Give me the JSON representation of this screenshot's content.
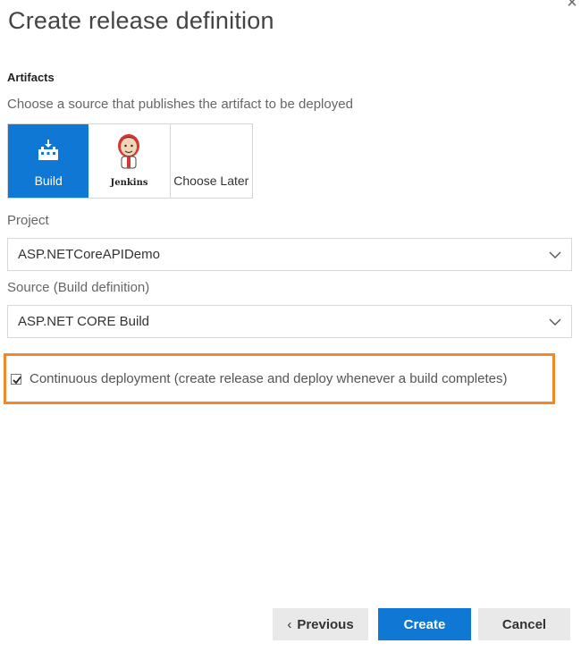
{
  "dialog": {
    "title": "Create release definition",
    "close_glyph": "×"
  },
  "artifacts": {
    "heading": "Artifacts",
    "description": "Choose a source that publishes the artifact to be deployed",
    "sources": [
      {
        "label": "Build",
        "icon": "build-icon",
        "selected": true
      },
      {
        "label": "Jenkins",
        "icon": "jenkins-logo",
        "selected": false
      },
      {
        "label": "Choose Later",
        "icon": null,
        "selected": false
      }
    ]
  },
  "project": {
    "label": "Project",
    "value": "ASP.NETCoreAPIDemo"
  },
  "source": {
    "label": "Source (Build definition)",
    "value": "ASP.NET CORE Build"
  },
  "continuous_deployment": {
    "checked": true,
    "label": "Continuous deployment (create release and deploy whenever a build completes)"
  },
  "footer": {
    "previous_label": "Previous",
    "previous_glyph": "‹",
    "create_label": "Create",
    "cancel_label": "Cancel"
  },
  "colors": {
    "accent": "#0f78d4",
    "highlight_border": "#f0892b",
    "button_gray": "#e9e9e9"
  }
}
